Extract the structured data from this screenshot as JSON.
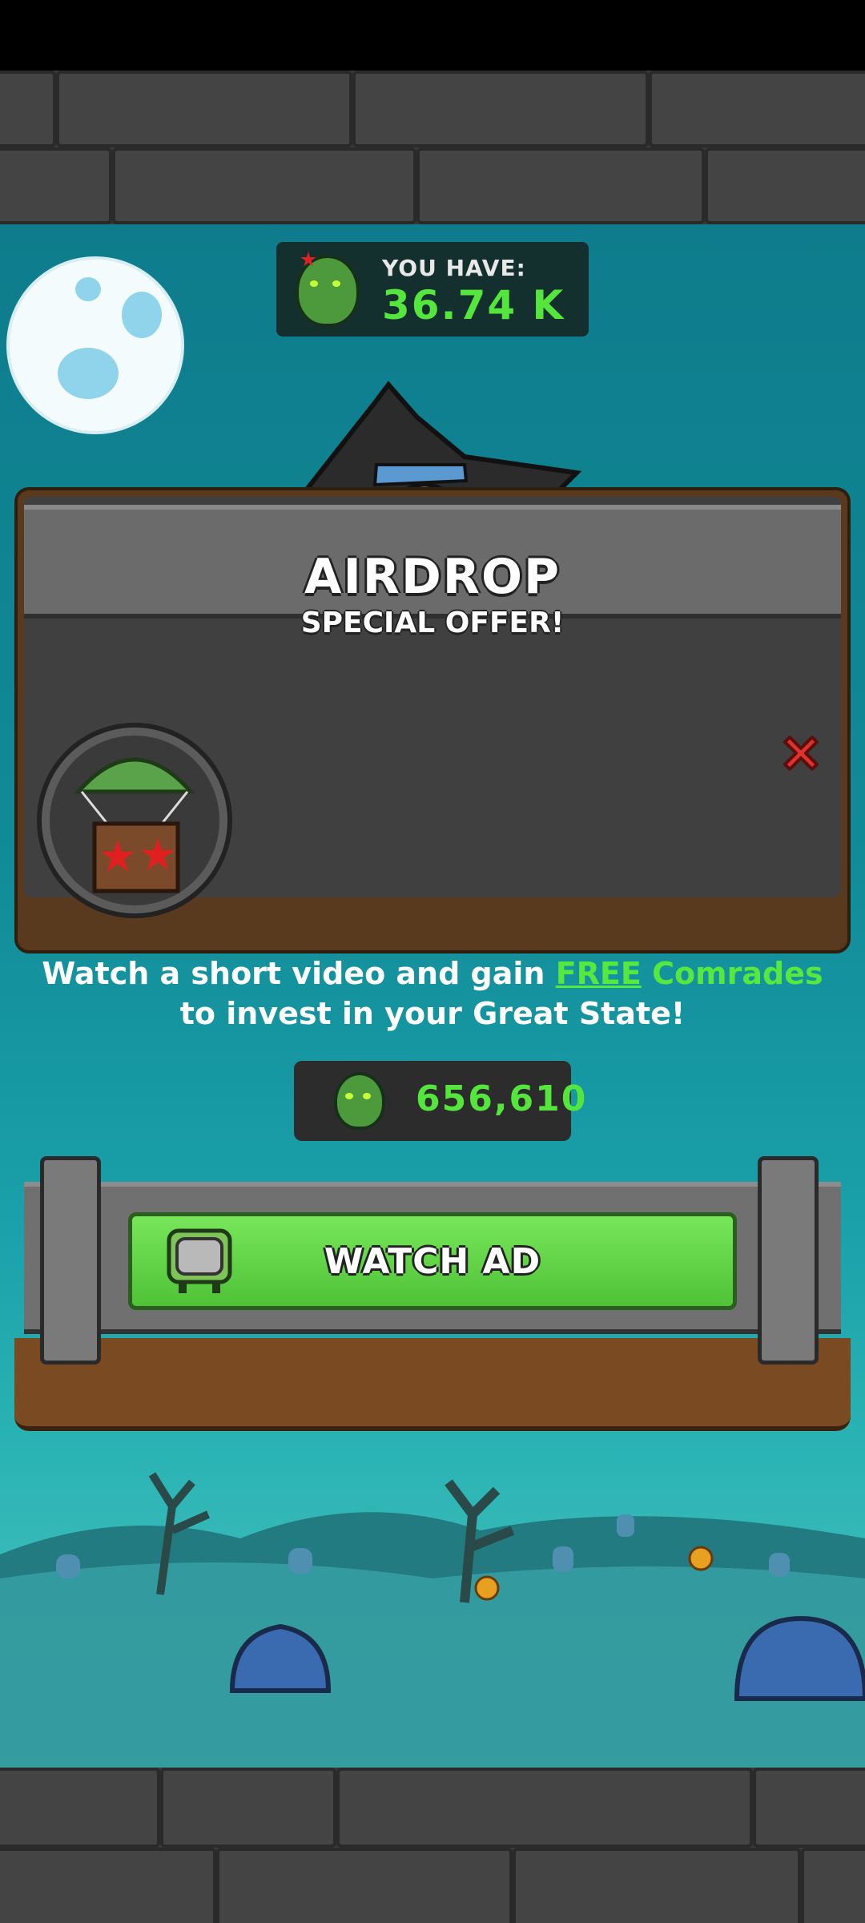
{
  "currency": {
    "label": "YOU HAVE:",
    "value": "36.74 K"
  },
  "dialog": {
    "title": "AIRDROP",
    "subtitle": "SPECIAL OFFER!",
    "desc_part1": "Watch a short video and gain ",
    "desc_free": "FREE",
    "desc_comrades": "Comrades",
    "desc_part2": "to invest in your Great State!",
    "reward_value": "656,610",
    "button_label": "WATCH AD"
  },
  "colors": {
    "accent_green": "#55e63d",
    "close_red": "#e0322d",
    "sky": "#118a97"
  },
  "icons": [
    "zombie-currency-icon",
    "close-icon",
    "airdrop-crate-icon",
    "tv-icon",
    "moon-icon"
  ]
}
